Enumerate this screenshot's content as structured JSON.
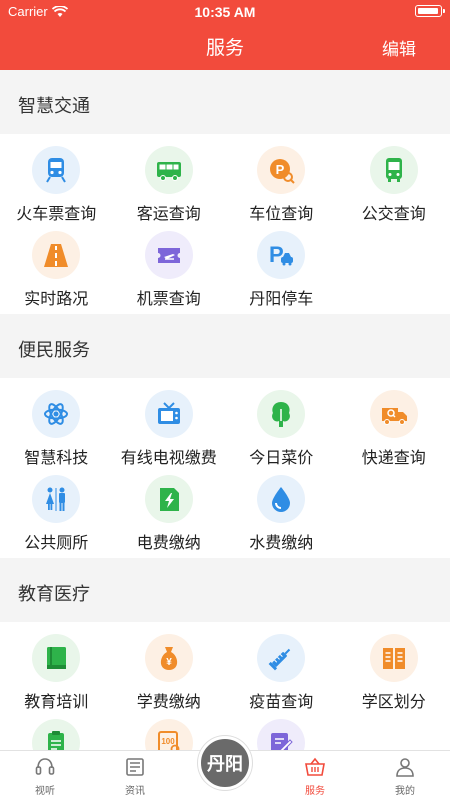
{
  "status_bar": {
    "carrier": "Carrier",
    "time": "10:35 AM"
  },
  "nav": {
    "title": "服务",
    "edit": "编辑"
  },
  "sections": [
    {
      "title": "智慧交通"
    },
    {
      "title": "便民服务"
    },
    {
      "title": "教育医疗"
    }
  ],
  "traffic": {
    "items": [
      {
        "label": "火车票查询",
        "icon": "train-icon"
      },
      {
        "label": "客运查询",
        "icon": "bus-icon"
      },
      {
        "label": "车位查询",
        "icon": "parking-spot-icon"
      },
      {
        "label": "公交查询",
        "icon": "city-bus-icon"
      },
      {
        "label": "实时路况",
        "icon": "road-icon"
      },
      {
        "label": "机票查询",
        "icon": "flight-ticket-icon"
      },
      {
        "label": "丹阳停车",
        "icon": "parking-car-icon"
      }
    ]
  },
  "convenience": {
    "items": [
      {
        "label": "智慧科技",
        "icon": "atom-icon"
      },
      {
        "label": "有线电视缴费",
        "icon": "tv-icon"
      },
      {
        "label": "今日菜价",
        "icon": "vegetable-icon"
      },
      {
        "label": "快递查询",
        "icon": "delivery-truck-icon"
      },
      {
        "label": "公共厕所",
        "icon": "restroom-icon"
      },
      {
        "label": "电费缴纳",
        "icon": "electricity-icon"
      },
      {
        "label": "水费缴纳",
        "icon": "water-drop-icon"
      }
    ]
  },
  "education": {
    "items": [
      {
        "label": "教育培训",
        "icon": "book-icon"
      },
      {
        "label": "学费缴纳",
        "icon": "money-bag-icon"
      },
      {
        "label": "疫苗查询",
        "icon": "syringe-icon"
      },
      {
        "label": "学区划分",
        "icon": "school-district-icon"
      },
      {
        "label": "",
        "icon": "clipboard-icon"
      },
      {
        "label": "",
        "icon": "score-100-icon"
      },
      {
        "label": "",
        "icon": "edit-doc-icon"
      }
    ]
  },
  "tabbar": {
    "tabs": [
      {
        "label": "视听",
        "icon": "audio-visual-icon"
      },
      {
        "label": "资讯",
        "icon": "news-icon"
      },
      {
        "label": "",
        "icon": "center-logo"
      },
      {
        "label": "服务",
        "icon": "basket-icon"
      },
      {
        "label": "我的",
        "icon": "person-icon"
      }
    ],
    "center_text": "丹阳",
    "active_color": "#f24b3c"
  },
  "colors": {
    "brand": "#f24b3c"
  }
}
